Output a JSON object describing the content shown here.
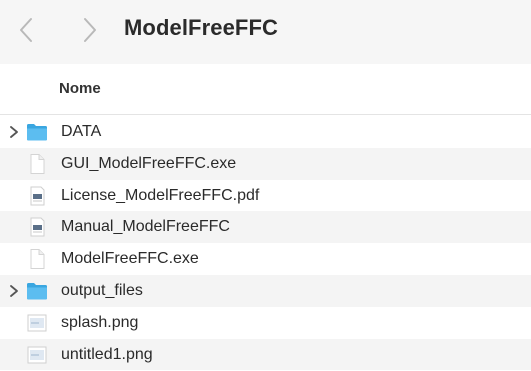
{
  "window": {
    "title": "ModelFreeFFC"
  },
  "nav": {
    "back_icon": "chevron-left-icon",
    "forward_icon": "chevron-right-icon"
  },
  "header": {
    "name_column": "Nome"
  },
  "files": [
    {
      "name": "DATA",
      "type": "folder",
      "expandable": true
    },
    {
      "name": "GUI_ModelFreeFFC.exe",
      "type": "exe",
      "expandable": false
    },
    {
      "name": "License_ModelFreeFFC.pdf",
      "type": "pdf",
      "expandable": false
    },
    {
      "name": "Manual_ModelFreeFFC",
      "type": "pdf",
      "expandable": false
    },
    {
      "name": "ModelFreeFFC.exe",
      "type": "exe",
      "expandable": false
    },
    {
      "name": "output_files",
      "type": "folder",
      "expandable": true
    },
    {
      "name": "splash.png",
      "type": "image",
      "expandable": false
    },
    {
      "name": "untitled1.png",
      "type": "image",
      "expandable": false
    }
  ],
  "colors": {
    "folder": "#4fb3e8",
    "toolbar_bg": "#f6f6f6",
    "alt_row": "#f4f4f4"
  }
}
